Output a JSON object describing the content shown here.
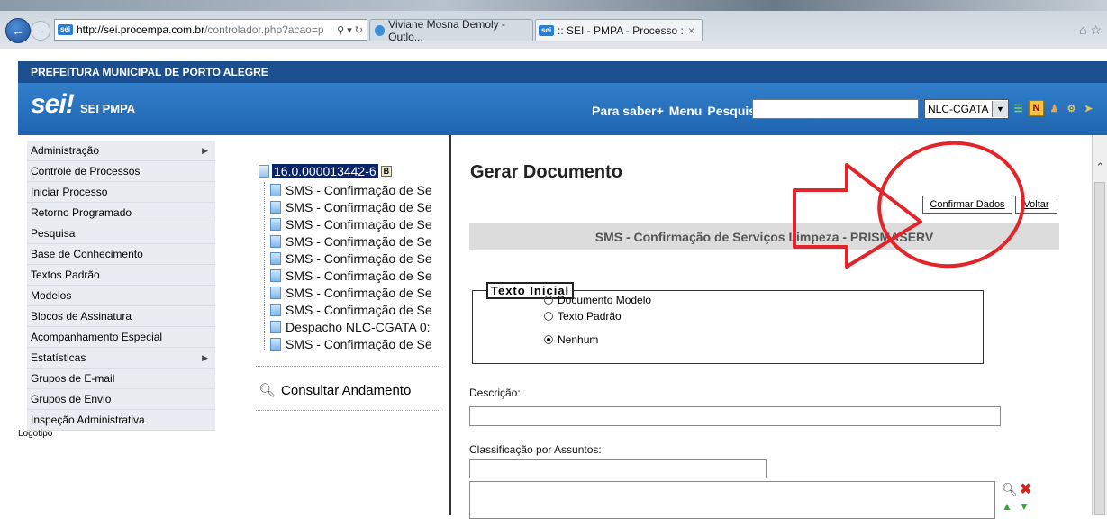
{
  "browser": {
    "address_host": "http://sei.procempa.com.br",
    "address_rest": "/controlador.php?acao=p",
    "address_icons": "⚲ ▾ ↻",
    "tabs": [
      {
        "label": "Viviane Mosna Demoly - Outlo..."
      },
      {
        "label": ":: SEI - PMPA - Processo ::",
        "close": "×"
      }
    ],
    "fav_label": "sei"
  },
  "header": {
    "org_name": "PREFEITURA MUNICIPAL DE PORTO ALEGRE",
    "logo": "sei!",
    "logo_sub": "SEI PMPA",
    "menu": [
      "Para saber+",
      "Menu",
      "Pesquisa"
    ],
    "search_value": "",
    "unit_selected": "NLC-CGATA",
    "icon_n": "N"
  },
  "sidebar": {
    "items": [
      {
        "label": "Administração",
        "has_sub": true
      },
      {
        "label": "Controle de Processos",
        "has_sub": false
      },
      {
        "label": "Iniciar Processo",
        "has_sub": false
      },
      {
        "label": "Retorno Programado",
        "has_sub": false
      },
      {
        "label": "Pesquisa",
        "has_sub": false
      },
      {
        "label": "Base de Conhecimento",
        "has_sub": false
      },
      {
        "label": "Textos Padrão",
        "has_sub": false
      },
      {
        "label": "Modelos",
        "has_sub": false
      },
      {
        "label": "Blocos de Assinatura",
        "has_sub": false
      },
      {
        "label": "Acompanhamento Especial",
        "has_sub": false
      },
      {
        "label": "Estatísticas",
        "has_sub": true
      },
      {
        "label": "Grupos de E-mail",
        "has_sub": false
      },
      {
        "label": "Grupos de Envio",
        "has_sub": false
      },
      {
        "label": "Inspeção Administrativa",
        "has_sub": false
      }
    ],
    "logotipo": "Logotipo"
  },
  "tree": {
    "root": "16.0.000013442-6",
    "root_badge": "B",
    "nodes": [
      "SMS - Confirmação de Se",
      "SMS - Confirmação de Se",
      "SMS - Confirmação de Se",
      "SMS - Confirmação de Se",
      "SMS - Confirmação de Se",
      "SMS - Confirmação de Se",
      "SMS - Confirmação de Se",
      "SMS - Confirmação de Se",
      "Despacho NLC-CGATA 0:",
      "SMS - Confirmação de Se"
    ],
    "consultar": "Consultar Andamento"
  },
  "main": {
    "title": "Gerar Documento",
    "confirm_label": "Confirmar Dados",
    "back_label": "Voltar",
    "subtitle": "SMS - Confirmação de Serviços Limpeza - PRISMASERV",
    "legend": "Texto Inicial",
    "radios": [
      {
        "label": "Documento Modelo",
        "checked": false
      },
      {
        "label": "Texto Padrão",
        "checked": false
      },
      {
        "label": "Nenhum",
        "checked": true
      }
    ],
    "descricao_label": "Descrição:",
    "descricao_value": "",
    "classificacao_label": "Classificação por Assuntos:",
    "classificacao_value": ""
  },
  "annotation": {
    "color": "#e0262b"
  }
}
